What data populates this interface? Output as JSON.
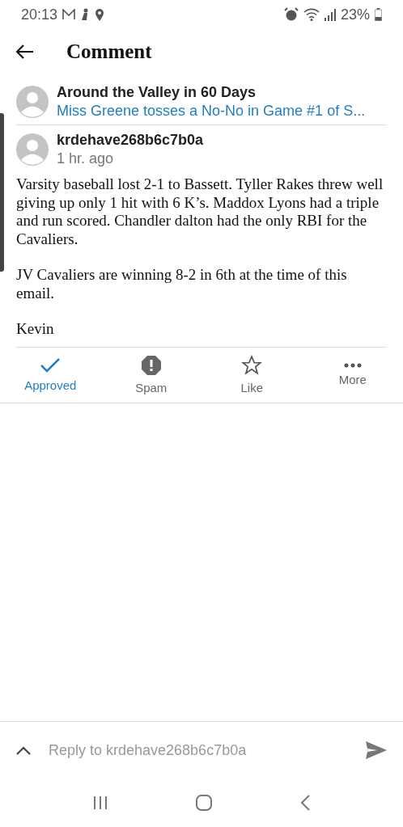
{
  "status_bar": {
    "time": "20:13",
    "battery": "23%"
  },
  "header": {
    "title": "Comment"
  },
  "post": {
    "site": "Around the Valley in 60 Days",
    "title": "Miss Greene tosses a No-No in Game #1 of S..."
  },
  "comment": {
    "author": "krdehave268b6c7b0a",
    "time": "1 hr. ago",
    "paragraphs": [
      "Varsity baseball lost 2-1 to Bassett. Tyller Rakes threw well giving up only 1 hit with 6 K’s. Maddox Lyons had a triple and run scored. Chandler dalton had the only RBI for the Cavaliers.",
      "JV Cavaliers are winning 8-2 in 6th at the time of this email.",
      "Kevin"
    ]
  },
  "actions": [
    {
      "kind": "check",
      "label": "Approved",
      "active": true
    },
    {
      "kind": "spam",
      "label": "Spam",
      "active": false
    },
    {
      "kind": "star",
      "label": "Like",
      "active": false
    },
    {
      "kind": "more",
      "label": "More",
      "active": false
    }
  ],
  "reply": {
    "placeholder": "Reply to krdehave268b6c7b0a"
  }
}
